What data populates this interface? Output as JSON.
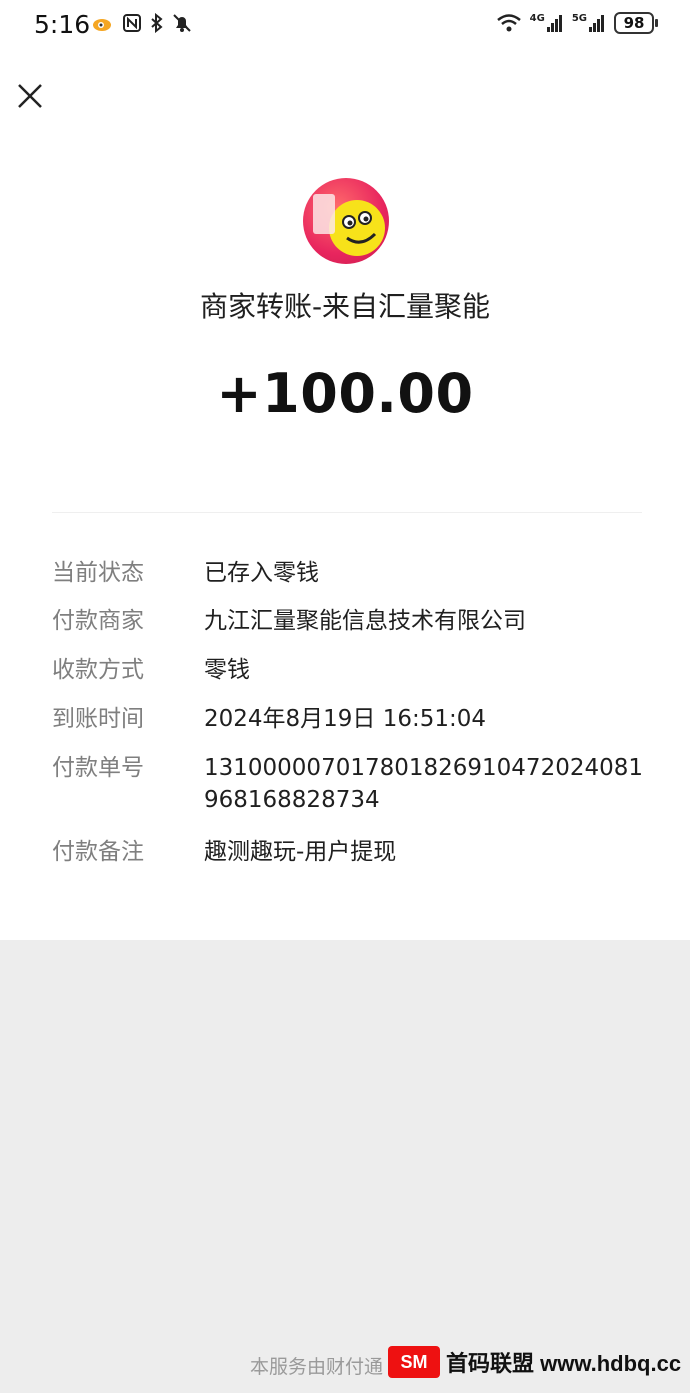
{
  "statusbar": {
    "time": "5:16",
    "net1": "4G",
    "net2": "5G",
    "battery": "98"
  },
  "header": {
    "merchant_title": "商家转账-来自汇量聚能",
    "amount": "+100.00"
  },
  "details": [
    {
      "label": "当前状态",
      "value": "已存入零钱"
    },
    {
      "label": "付款商家",
      "value": "九江汇量聚能信息技术有限公司"
    },
    {
      "label": "收款方式",
      "value": "零钱"
    },
    {
      "label": "到账时间",
      "value": "2024年8月19日 16:51:04"
    },
    {
      "label": "付款单号",
      "value": "131000007017801826910472024081968168828734"
    },
    {
      "label": "付款备注",
      "value": "趣测趣玩-用户提现"
    }
  ],
  "footer": {
    "text": "本服务由财付通"
  },
  "watermark": {
    "logo": "SM",
    "text": "首码联盟 www.hdbq.cc"
  },
  "colors": {
    "card_bg": "#ffffff",
    "page_bg": "#ededed",
    "label": "#7f7f7f",
    "value": "#1f1f1f"
  }
}
